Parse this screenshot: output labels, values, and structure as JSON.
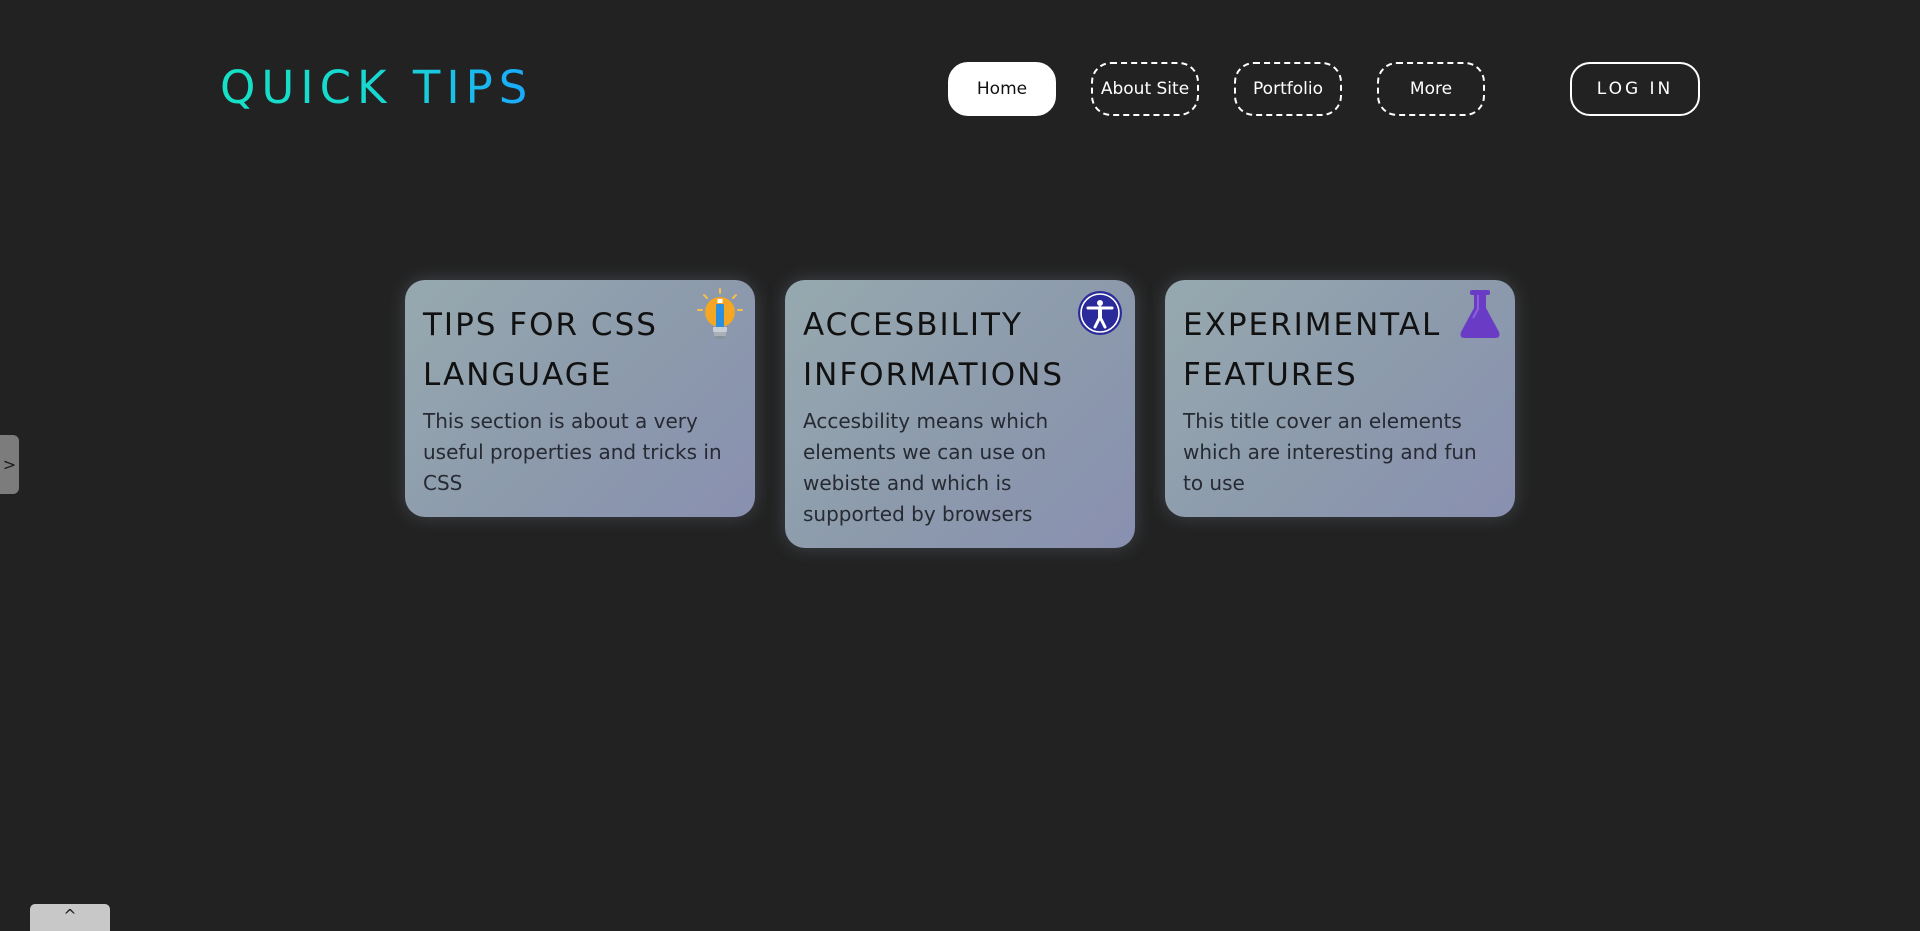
{
  "header": {
    "logo": "QUICK TIPS",
    "nav": [
      {
        "label": "Home",
        "active": true
      },
      {
        "label": "About Site",
        "active": false
      },
      {
        "label": "Portfolio",
        "active": false
      },
      {
        "label": "More",
        "active": false
      }
    ],
    "login_label": "LOG IN"
  },
  "cards": [
    {
      "title": "TIPS FOR CSS LANGUAGE",
      "text": "This section is about a very useful properties and tricks in CSS",
      "icon": "lightbulb-icon"
    },
    {
      "title": "ACCESBILITY INFORMATIONS",
      "text": "Accesbility means which elements we can use on webiste and which is supported by browsers",
      "icon": "accessibility-icon"
    },
    {
      "title": "EXPERIMENTAL FEATURES",
      "text": "This title cover an elements which are interesting and fun to use",
      "icon": "flask-icon"
    }
  ],
  "side_toggle": {
    "glyph": ">"
  },
  "scroll_top": {
    "glyph": "^"
  },
  "colors": {
    "background": "#222222",
    "logo_gradient_start": "#16e0c5",
    "logo_gradient_end": "#1aa8ff",
    "card_gradient_start": "#97a9af",
    "card_gradient_end": "#8990b0",
    "lightbulb": "#f5a623",
    "accessibility": "#2a2a9a",
    "flask": "#6a3bc4"
  }
}
